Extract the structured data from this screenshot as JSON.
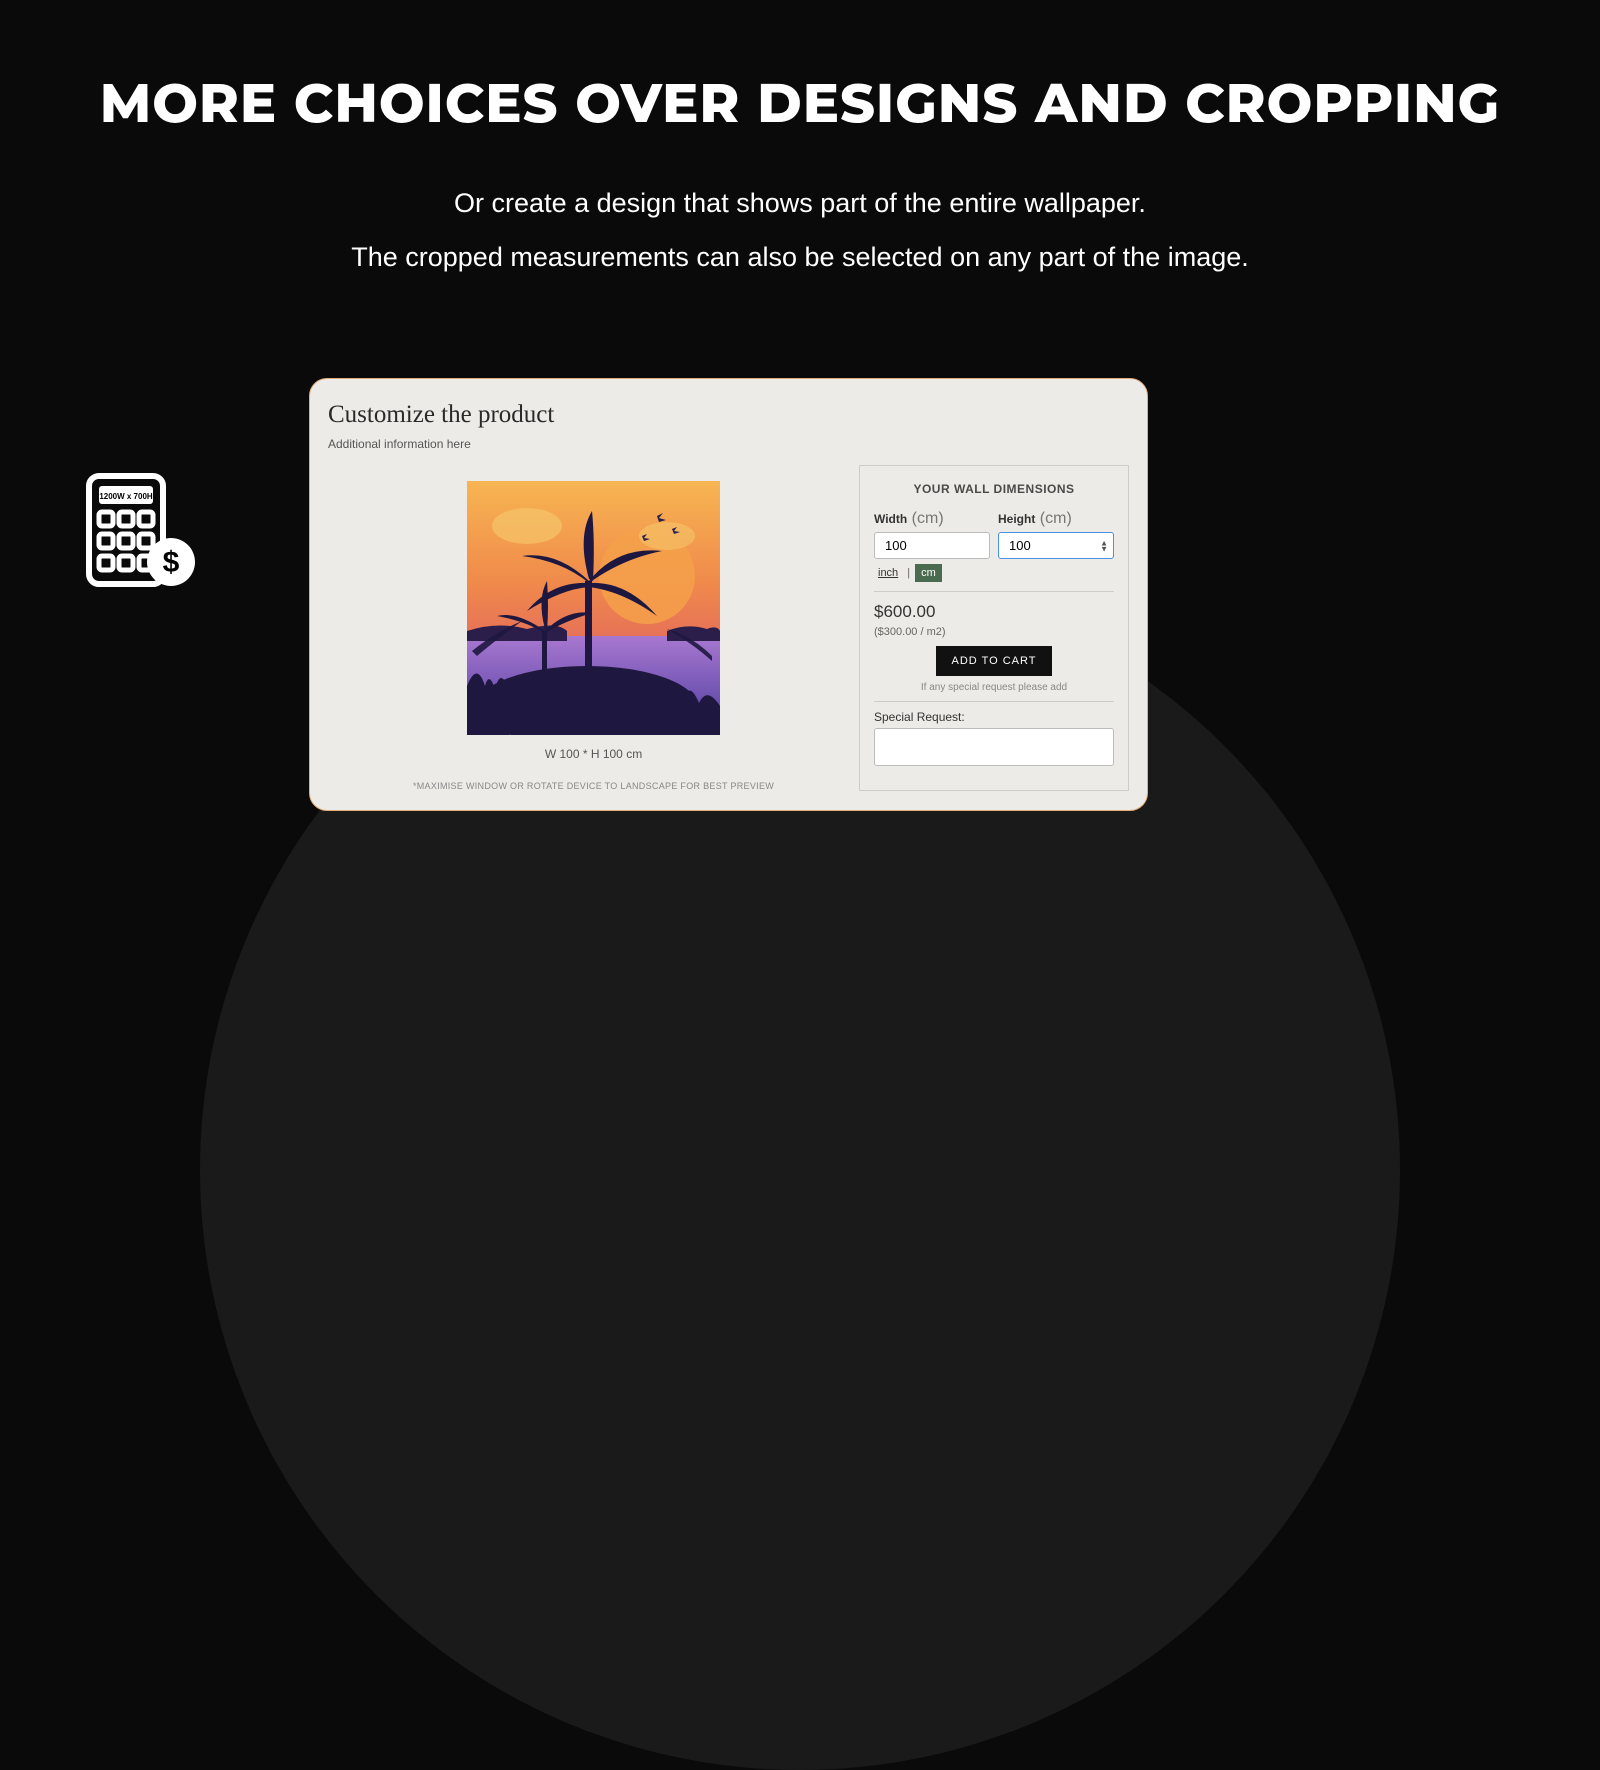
{
  "heading": "MORE CHOICES OVER DESIGNS AND CROPPING",
  "subtext_line1": "Or create a design that shows part of the entire wallpaper.",
  "subtext_line2": "The cropped measurements can also be selected on any part of the image.",
  "calc_badge": "1200W x 700H",
  "panel": {
    "title": "Customize the product",
    "subtitle": "Additional information here",
    "preview_dims": "W 100 * H 100 cm",
    "maximize_note": "*MAXIMISE WINDOW OR ROTATE DEVICE TO LANDSCAPE FOR BEST PREVIEW"
  },
  "config": {
    "header": "YOUR WALL DIMENSIONS",
    "width_label": "Width",
    "width_unit": "(cm)",
    "width_value": "100",
    "height_label": "Height",
    "height_unit": "(cm)",
    "height_value": "100",
    "unit_inch": "inch",
    "unit_cm": "cm",
    "price": "$600.00",
    "price_per": "($300.00 / m2)",
    "add_to_cart": "ADD TO CART",
    "request_note": "If any special request please add",
    "special_label": "Special Request:"
  }
}
